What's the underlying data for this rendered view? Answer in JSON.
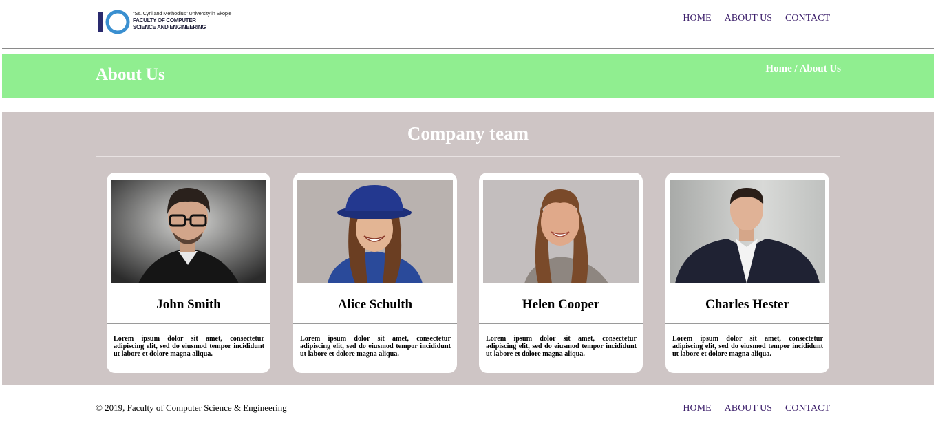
{
  "header": {
    "logo": {
      "monogram": "IO",
      "line1": "\"Ss. Cyril and Methodius\" University in Skopje",
      "line2": "FACULTY OF COMPUTER",
      "line3": "SCIENCE AND ENGINEERING"
    },
    "nav": [
      "HOME",
      "ABOUT US",
      "CONTACT"
    ]
  },
  "banner": {
    "title": "About Us",
    "breadcrumb": "Home / About Us",
    "color": "#90ee90"
  },
  "team": {
    "title": "Company team",
    "background": "#cec5c5",
    "members": [
      {
        "name": "John Smith",
        "bio": "Lorem ipsum dolor sit amet, consectetur adipiscing elit, sed do eiusmod tempor incididunt ut labore et dolore magna aliqua.",
        "photo": "man-with-glasses-photo"
      },
      {
        "name": "Alice Schulth",
        "bio": "Lorem ipsum dolor sit amet, consectetur adipiscing elit, sed do eiusmod tempor incididunt ut labore et dolore magna aliqua.",
        "photo": "woman-with-hat-photo"
      },
      {
        "name": "Helen Cooper",
        "bio": "Lorem ipsum dolor sit amet, consectetur adipiscing elit, sed do eiusmod tempor incididunt ut labore et dolore magna aliqua.",
        "photo": "smiling-woman-photo"
      },
      {
        "name": "Charles Hester",
        "bio": "Lorem ipsum dolor sit amet, consectetur adipiscing elit, sed do eiusmod tempor incididunt ut labore et dolore magna aliqua.",
        "photo": "man-in-suit-photo"
      }
    ]
  },
  "footer": {
    "copyright": "© 2019, Faculty of Computer Science & Engineering",
    "nav": [
      "HOME",
      "ABOUT US",
      "CONTACT"
    ]
  },
  "colors": {
    "nav_link": "#3c1f6b",
    "logo_blue": "#3a8fd0",
    "logo_navy": "#2a2a6e"
  }
}
